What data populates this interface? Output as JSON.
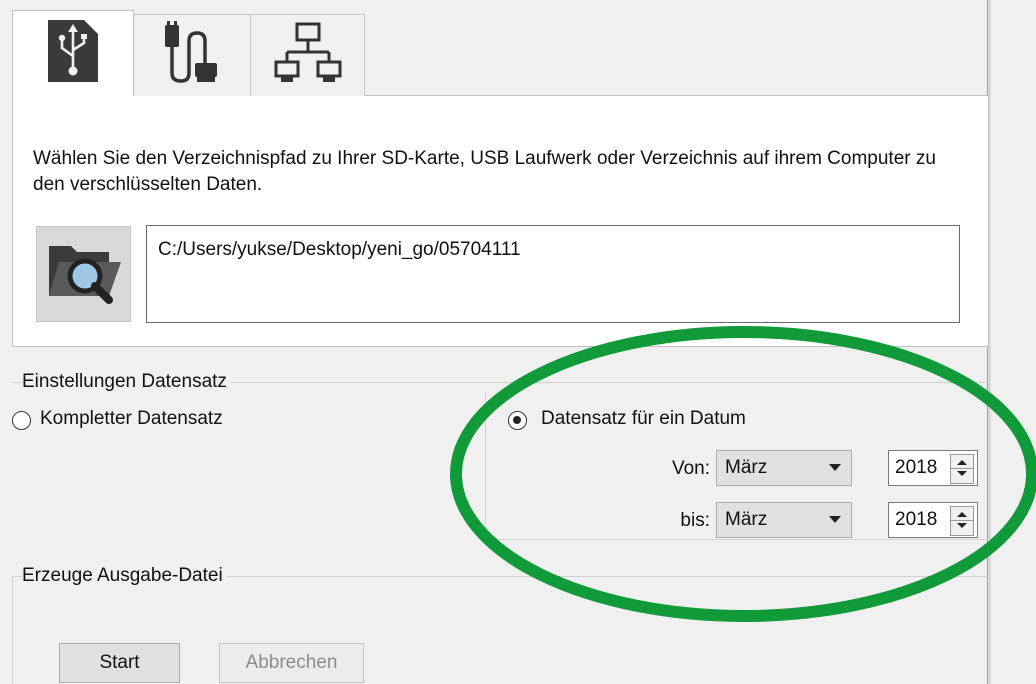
{
  "tabs": [
    {
      "label": "",
      "icon": "sd-card-usb-icon",
      "selected": true
    },
    {
      "label": "",
      "icon": "cable-icon",
      "selected": false
    },
    {
      "label": "",
      "icon": "network-icon",
      "selected": false
    }
  ],
  "source": {
    "description": "Wählen Sie den Verzeichnispfad zu Ihrer SD-Karte, USB Laufwerk oder Verzeichnis auf ihrem Computer zu den verschlüsselten Daten.",
    "browse_icon": "folder-search-icon",
    "path": "C:/Users/yukse/Desktop/yeni_go/05704111"
  },
  "settings": {
    "legend": "Einstellungen Datensatz",
    "option_complete": "Kompletter Datensatz",
    "option_date": "Datensatz für ein Datum",
    "selected_option": "date",
    "from_label": "Von:",
    "from_month": "März",
    "from_year": "2018",
    "to_label": "bis:",
    "to_month": "März",
    "to_year": "2018"
  },
  "output": {
    "legend": "Erzeuge Ausgabe-Datei",
    "start_label": "Start",
    "cancel_label": "Abbrechen"
  },
  "colors": {
    "highlight": "#119a39",
    "panel_bg": "#ffffff",
    "window_bg": "#f0f0f0"
  }
}
